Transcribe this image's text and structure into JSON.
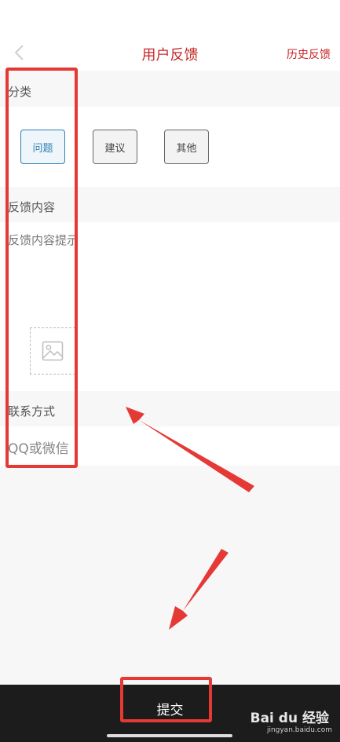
{
  "header": {
    "title": "用户反馈",
    "history_label": "历史反馈"
  },
  "category": {
    "label": "分类",
    "options": [
      {
        "label": "问题",
        "selected": true
      },
      {
        "label": "建议",
        "selected": false
      },
      {
        "label": "其他",
        "selected": false
      }
    ]
  },
  "content": {
    "label": "反馈内容",
    "placeholder": "反馈内容提示"
  },
  "contact": {
    "label": "联系方式",
    "placeholder": "QQ或微信"
  },
  "footer": {
    "submit_label": "提交"
  },
  "watermark": {
    "brand": "Bai du 经验",
    "url": "jingyan.baidu.com"
  },
  "colors": {
    "accent": "#c62828",
    "selected": "#2f7fb4",
    "annotation": "#e53935"
  }
}
